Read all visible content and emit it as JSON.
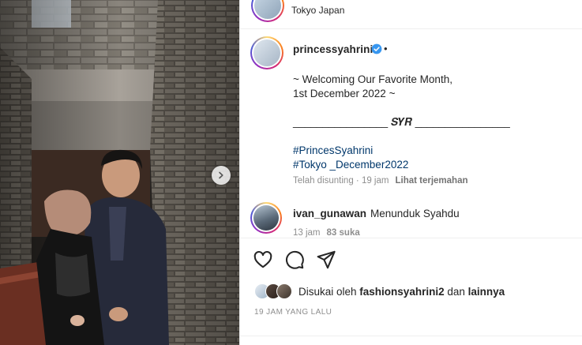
{
  "header": {
    "location": "Tokyo Japan"
  },
  "post": {
    "username": "princessyahrini",
    "dot": "•",
    "caption": {
      "line1": "~ Welcoming Our Favorite Month,",
      "line2": "1st December 2022 ~",
      "line3": "________________ 𝑺𝒀𝑹 ________________",
      "tag1": "#PrincesSyahrini",
      "tag2": "#Tokyo",
      "tag2_rest": " _December2022"
    },
    "meta": {
      "edited": "Telah disunting · 19 jam",
      "see_translation": "Lihat terjemahan"
    }
  },
  "comment": {
    "username": "ivan_gunawan",
    "text": "Menunduk Syahdu",
    "time": "13 jam",
    "likes": "83 suka"
  },
  "likes": {
    "prefix": "Disukai oleh ",
    "user": "fashionsyahrini2",
    "middle": " dan ",
    "others": "lainnya"
  },
  "timestamp": "19 JAM YANG LALU",
  "colors": {
    "verified": "#3897f0",
    "hashtag": "#00376b",
    "muted": "#8e8e8e"
  },
  "icons": [
    "chevron-right-icon",
    "verified-icon",
    "heart-icon",
    "comment-icon",
    "share-icon"
  ]
}
